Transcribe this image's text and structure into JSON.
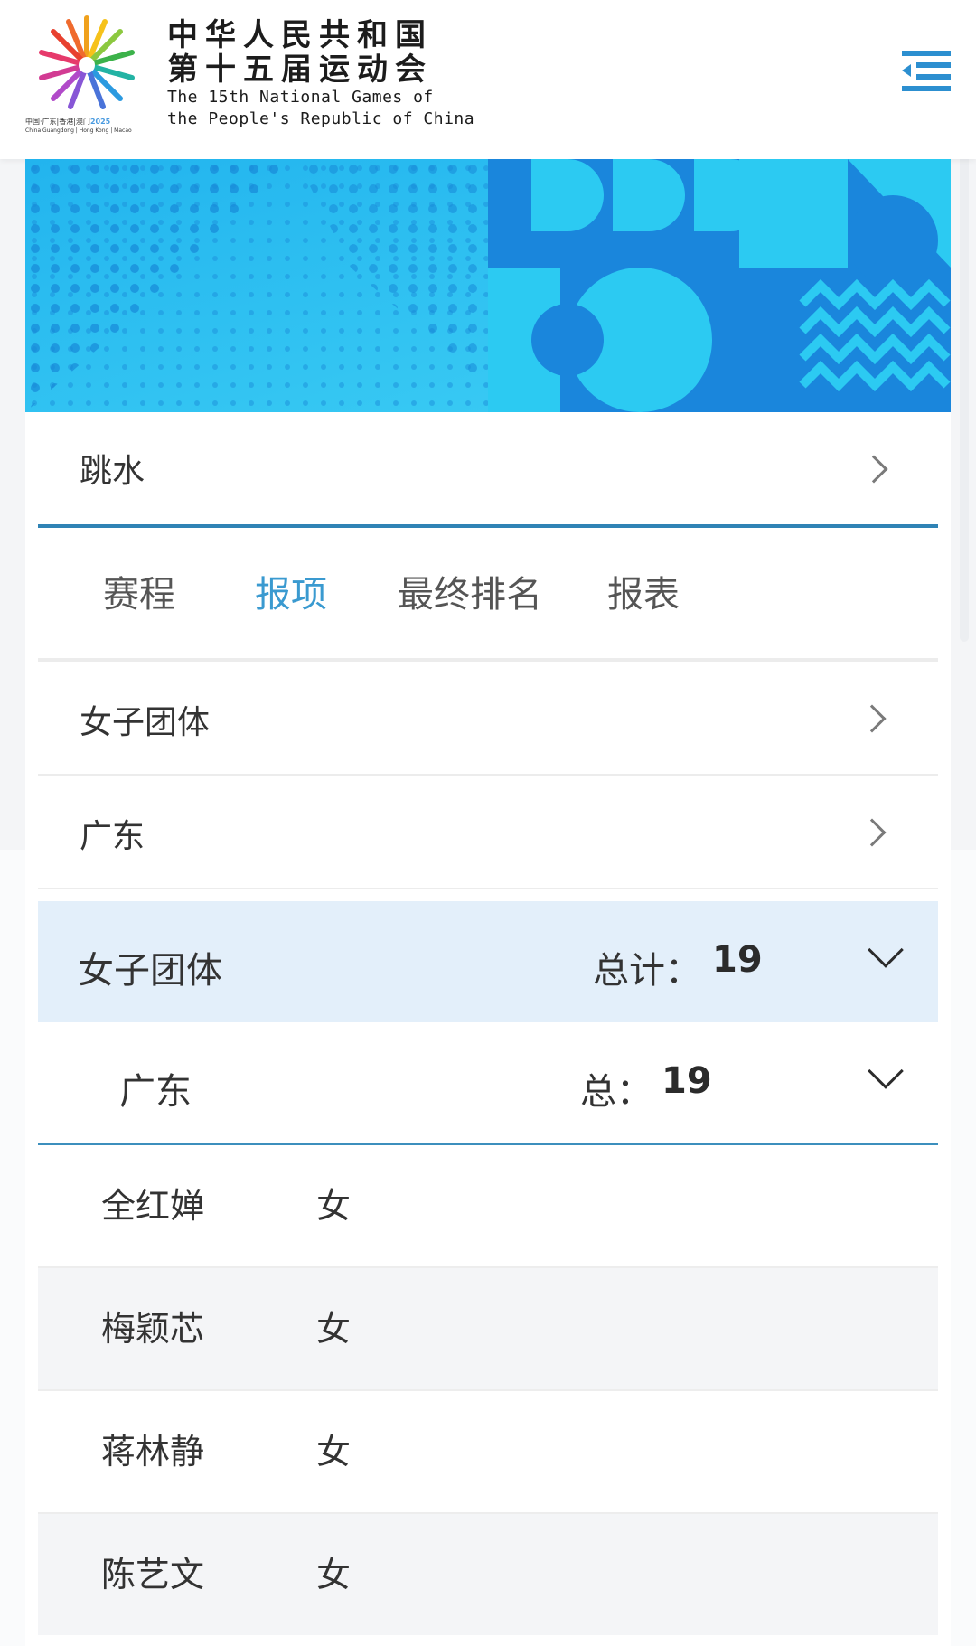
{
  "header": {
    "title_cn_line1": "中华人民共和国",
    "title_cn_line2": "第十五届运动会",
    "title_en_line1": "The 15th National Games of",
    "title_en_line2": "the People's Republic of China",
    "logo_caption_cn": "中国·广东|香港|澳门",
    "logo_caption_year": "2025",
    "logo_caption_en": "China Guangdong | Hong Kong | Macao",
    "menu_icon": "menu-indent-icon"
  },
  "sport": {
    "label": "跳水"
  },
  "tabs": [
    {
      "label": "赛程",
      "active": false
    },
    {
      "label": "报项",
      "active": true
    },
    {
      "label": "最终排名",
      "active": false
    },
    {
      "label": "报表",
      "active": false
    }
  ],
  "filters": {
    "event": "女子团体",
    "delegation": "广东"
  },
  "group": {
    "event": "女子团体",
    "total_label": "总计：",
    "total_value": "19"
  },
  "subgroup": {
    "delegation": "广东",
    "total_label": "总：",
    "total_value": "19"
  },
  "athletes": [
    {
      "name": "全红婵",
      "gender": "女"
    },
    {
      "name": "梅颖芯",
      "gender": "女"
    },
    {
      "name": "蒋林静",
      "gender": "女"
    },
    {
      "name": "陈艺文",
      "gender": "女"
    }
  ],
  "colors": {
    "accent": "#3a9ad0",
    "divider": "#2f83b5",
    "group_bg": "#e3effa",
    "banner_light": "#27c3f0",
    "banner_dark": "#1a86dc"
  }
}
